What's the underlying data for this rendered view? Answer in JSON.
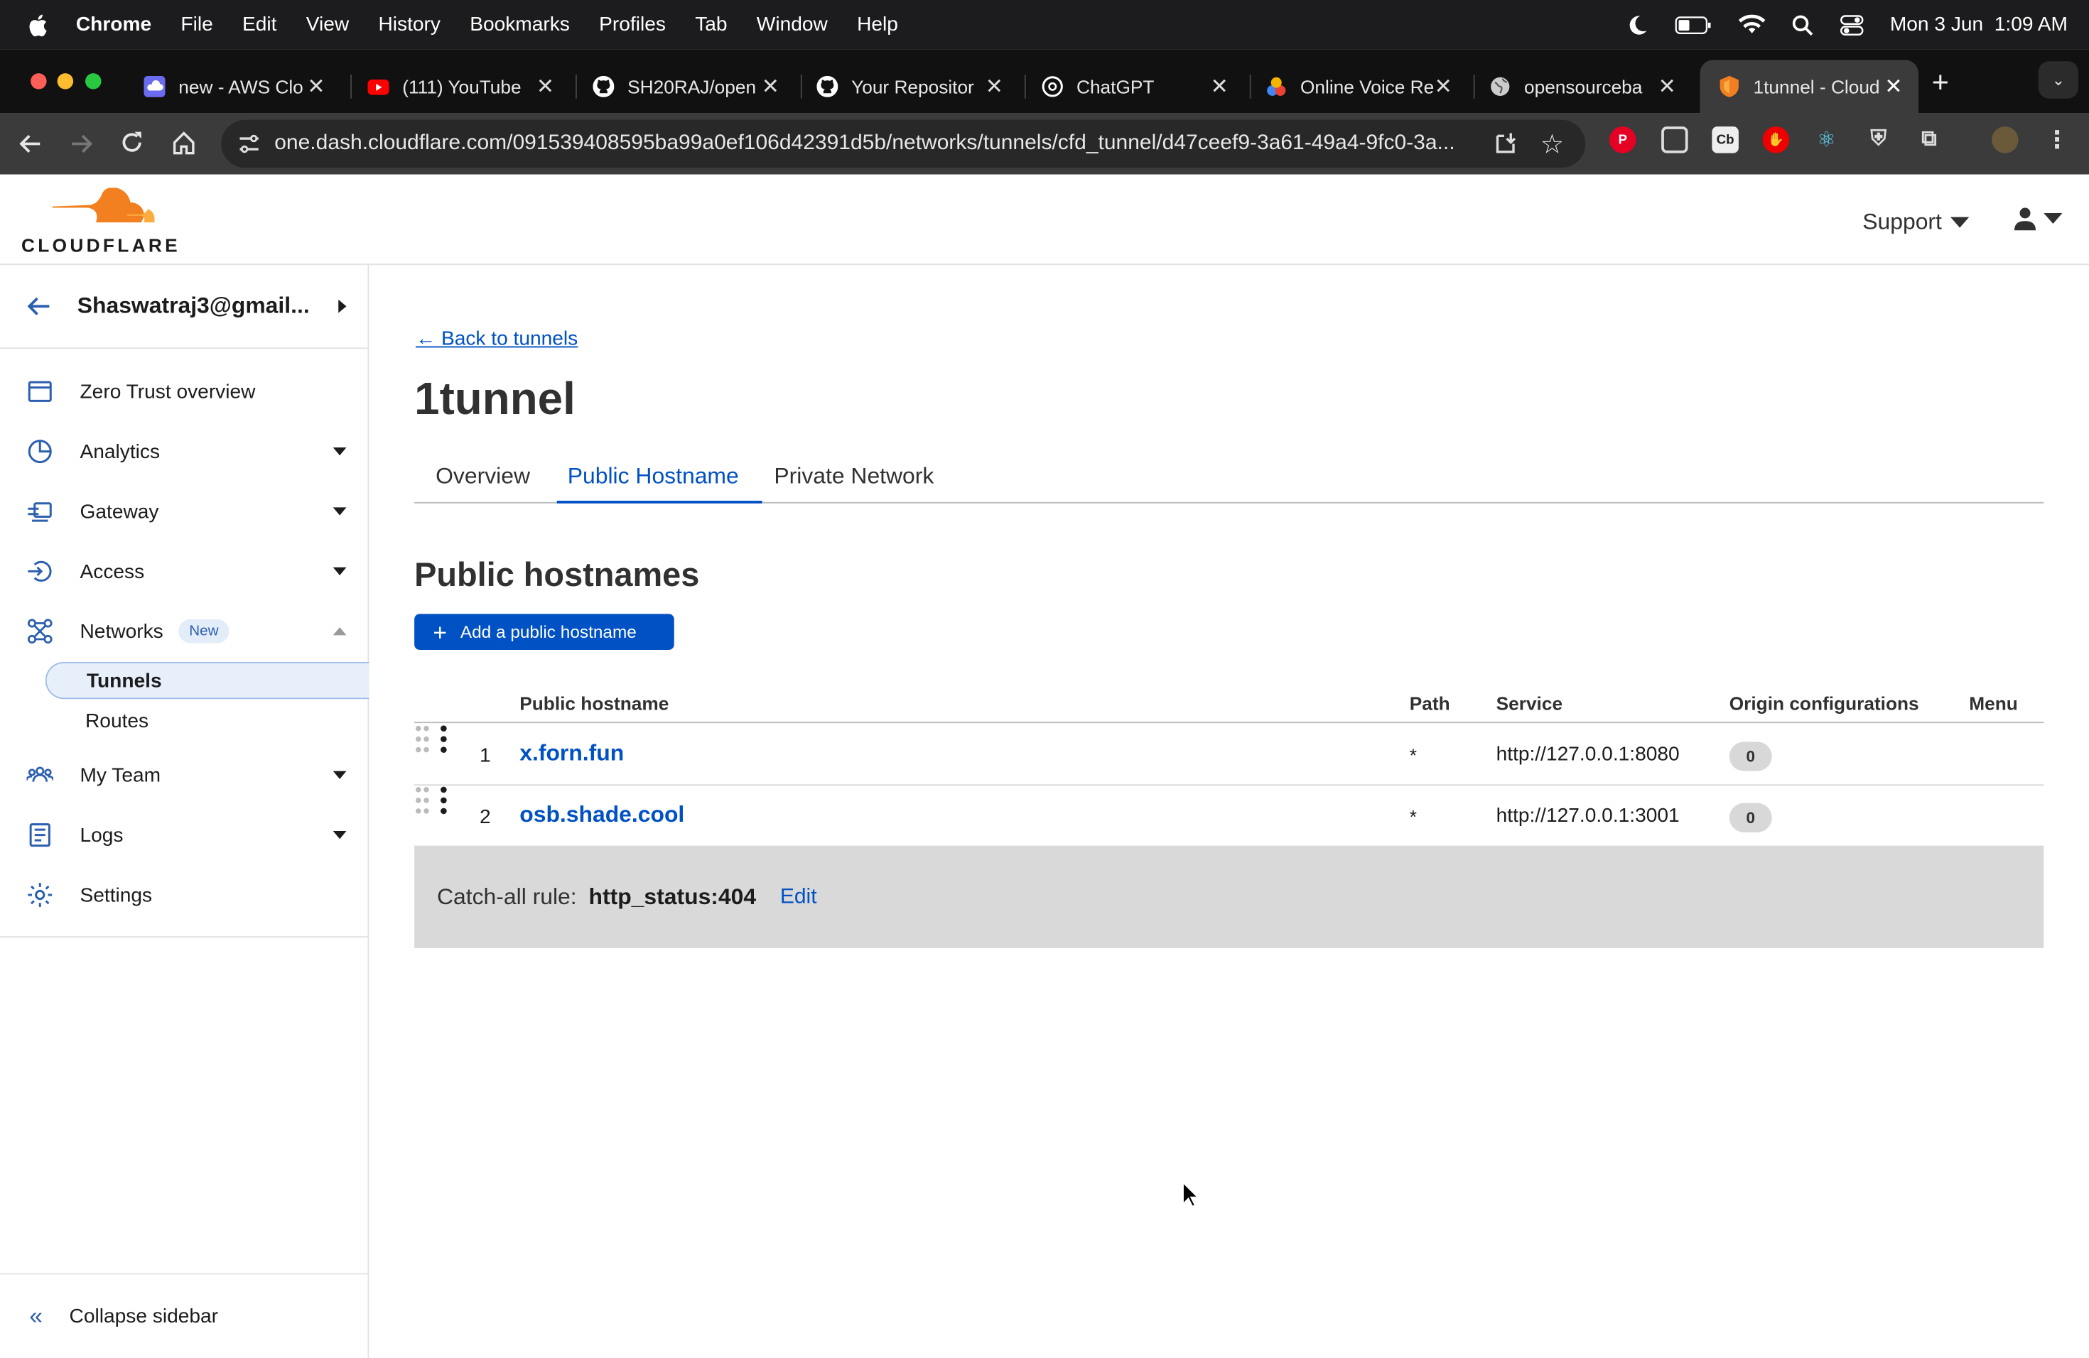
{
  "menubar": {
    "app": "Chrome",
    "items": [
      "File",
      "Edit",
      "View",
      "History",
      "Bookmarks",
      "Profiles",
      "Tab",
      "Window",
      "Help"
    ],
    "datetime": "Mon 3 Jun  1:09 AM"
  },
  "tabs": [
    {
      "title": "new - AWS Clo",
      "favicon": "aws-cloud-icon",
      "color": "#6b6bf0"
    },
    {
      "title": "(111) YouTube",
      "favicon": "youtube-icon",
      "color": "#ff0000"
    },
    {
      "title": "SH20RAJ/open",
      "favicon": "github-icon",
      "color": "#ffffff"
    },
    {
      "title": "Your Repositor",
      "favicon": "github-icon",
      "color": "#ffffff"
    },
    {
      "title": "ChatGPT",
      "favicon": "chatgpt-icon",
      "color": "#ffffff"
    },
    {
      "title": "Online Voice Re",
      "favicon": "voice-recorder-icon",
      "color": "#f4b400"
    },
    {
      "title": "opensourceba",
      "favicon": "globe-icon",
      "color": "#cccccc"
    },
    {
      "title": "1tunnel - Cloud",
      "favicon": "cloudflare-shield-icon",
      "color": "#f38020",
      "active": true
    }
  ],
  "toolbar": {
    "url": "one.dash.cloudflare.com/091539408595ba99a0ef106d42391d5b/networks/tunnels/cfd_tunnel/d47ceef9-3a61-49a4-9fc0-3a..."
  },
  "header": {
    "logo_text": "CLOUDFLARE",
    "support_label": "Support"
  },
  "sidebar": {
    "account": "Shaswatraj3@gmail...",
    "items": [
      {
        "label": "Zero Trust overview",
        "icon": "browser-window-icon"
      },
      {
        "label": "Analytics",
        "icon": "pie-chart-icon"
      },
      {
        "label": "Gateway",
        "icon": "gateway-icon"
      },
      {
        "label": "Access",
        "icon": "access-icon"
      },
      {
        "label": "Networks",
        "icon": "network-icon",
        "badge": "New"
      },
      {
        "label": "My Team",
        "icon": "team-icon"
      },
      {
        "label": "Logs",
        "icon": "logs-icon"
      },
      {
        "label": "Settings",
        "icon": "gear-icon"
      }
    ],
    "subitems": [
      "Tunnels",
      "Routes"
    ],
    "collapse_label": "Collapse sidebar"
  },
  "main": {
    "back_link": "← Back to tunnels",
    "title": "1tunnel",
    "tabs": [
      "Overview",
      "Public Hostname",
      "Private Network"
    ],
    "active_tab": "Public Hostname",
    "section_title": "Public hostnames",
    "add_button": "Add a public hostname",
    "table": {
      "headers": [
        "Public hostname",
        "Path",
        "Service",
        "Origin configurations",
        "Menu"
      ],
      "rows": [
        {
          "num": "1",
          "hostname": "x.forn.fun",
          "path": "*",
          "service": "http://127.0.0.1:8080",
          "origin": "0"
        },
        {
          "num": "2",
          "hostname": "osb.shade.cool",
          "path": "*",
          "service": "http://127.0.0.1:3001",
          "origin": "0"
        }
      ]
    },
    "catchall": {
      "label": "Catch-all rule:",
      "value": "http_status:404",
      "edit": "Edit"
    }
  },
  "colors": {
    "accent": "#0051c3",
    "brand_orange": "#f38020"
  }
}
